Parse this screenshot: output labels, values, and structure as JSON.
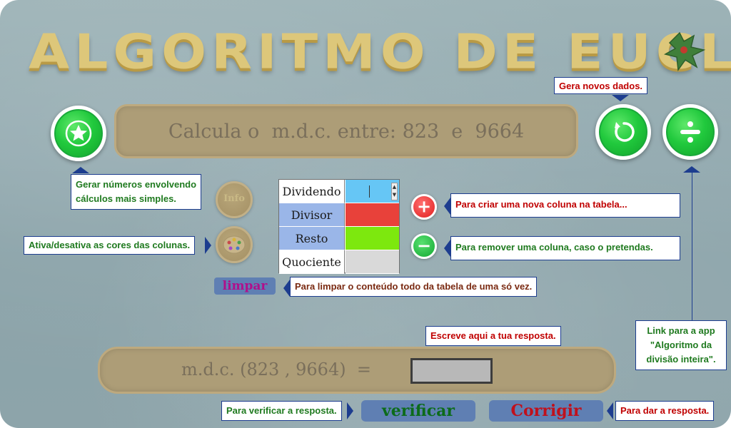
{
  "app": {
    "title": "ALGORITMO DE EUCLIDES",
    "question": "Calcula o  m.d.c. entre: 823  e  9664"
  },
  "table": {
    "rows": [
      {
        "label": "Dividendo",
        "color": "#66c6f5"
      },
      {
        "label": "Divisor",
        "color": "#e8413a"
      },
      {
        "label": "Resto",
        "color": "#7de80e"
      },
      {
        "label": "Quociente",
        "color": "#d9d9d9"
      }
    ]
  },
  "buttons": {
    "info_label": "Info",
    "limpar": "limpar",
    "verificar": "verificar",
    "corrigir": "Corrigir"
  },
  "answer": {
    "label": "m.d.c. (823 , 9664)  ="
  },
  "callouts": {
    "novos_dados": "Gera novos dados.",
    "simples": "Gerar números envolvendo\ncálculos mais simples.",
    "cores": "Ativa/desativa as cores das colunas.",
    "nova_coluna": "Para criar uma nova coluna na tabela...",
    "remover": "Para remover uma coluna, caso o pretendas.",
    "limpar": "Para limpar o conteúdo todo da tabela de uma só vez.",
    "resposta": "Escreve aqui a tua resposta.",
    "link": "Link para a app\n\"Algoritmo da\ndivisão inteira\".",
    "verificar": "Para verificar a resposta.",
    "dar_resposta": "Para dar a resposta."
  },
  "colors": {
    "accent_blue": "#1d3d8f",
    "green_text": "#1f7a1f",
    "red_text": "#c00000"
  }
}
